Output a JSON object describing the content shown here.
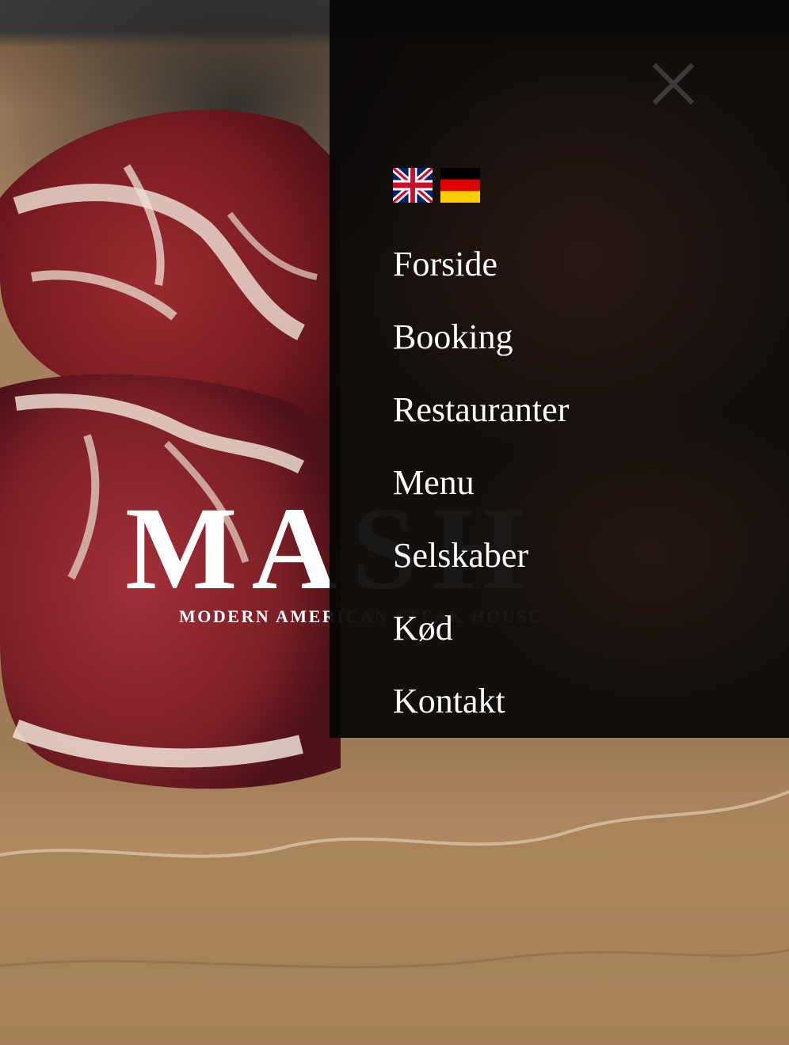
{
  "brand": {
    "name": "MASH",
    "tagline": "MODERN AMERICAN STEAK HOUSE"
  },
  "menu": {
    "close_icon": "close-icon",
    "languages": [
      {
        "code": "en",
        "label": "English",
        "icon": "uk-flag-icon"
      },
      {
        "code": "de",
        "label": "Deutsch",
        "icon": "german-flag-icon"
      }
    ],
    "items": [
      {
        "label": "Forside"
      },
      {
        "label": "Booking"
      },
      {
        "label": "Restauranter"
      },
      {
        "label": "Menu"
      },
      {
        "label": "Selskaber"
      },
      {
        "label": "Kød"
      },
      {
        "label": "Kontakt"
      }
    ]
  },
  "colors": {
    "panel_background": "#080606",
    "menu_text": "#ffffff",
    "close_icon": "#3a3a3a",
    "logo_text": "#ffffff"
  }
}
